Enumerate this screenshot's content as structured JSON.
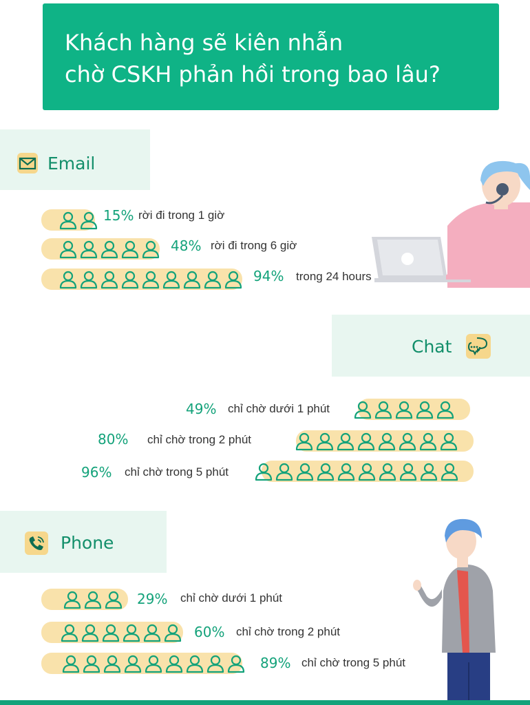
{
  "title": {
    "line1": "Khách hàng sẽ kiên nhẫn",
    "line2": "chờ CSKH phản hồi trong bao lâu?"
  },
  "email": {
    "label": "Email",
    "icon": "envelope-icon",
    "rows": [
      {
        "pct": "15%",
        "text": "rời đi trong 1 giờ",
        "people": 2
      },
      {
        "pct": "48%",
        "text": "rời đi trong 6 giờ",
        "people": 5
      },
      {
        "pct": "94%",
        "text": "trong 24 hours",
        "people": 9
      }
    ]
  },
  "chat": {
    "label": "Chat",
    "icon": "chat-bubbles-icon",
    "rows": [
      {
        "pct": "49%",
        "text": "chỉ chờ dưới 1 phút",
        "people": 5
      },
      {
        "pct": "80%",
        "text": "chỉ chờ trong 2 phút",
        "people": 8
      },
      {
        "pct": "96%",
        "text": "chỉ chờ trong 5 phút",
        "people": 10
      }
    ]
  },
  "phone": {
    "label": "Phone",
    "icon": "phone-icon",
    "rows": [
      {
        "pct": "29%",
        "text": "chỉ chờ dưới 1 phút",
        "people": 3
      },
      {
        "pct": "60%",
        "text": "chỉ chờ trong 2 phút",
        "people": 6
      },
      {
        "pct": "89%",
        "text": "chỉ chờ trong 5 phút",
        "people": 9
      }
    ]
  },
  "colors": {
    "accent": "#0fb386",
    "pill": "#f9e2ab",
    "person_outline": "#13a27a",
    "panel": "#e8f6f0"
  }
}
